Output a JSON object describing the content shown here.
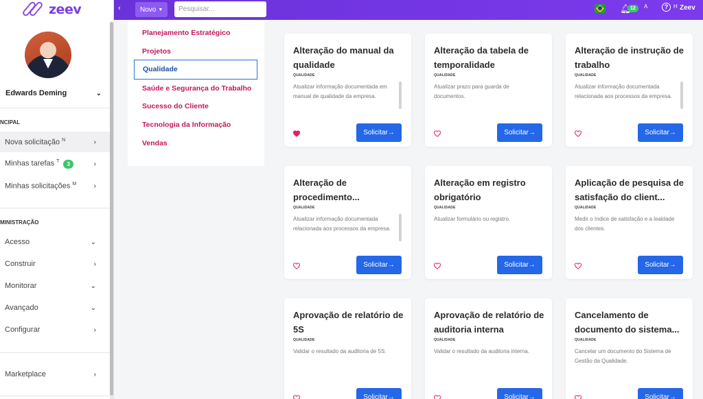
{
  "brand": {
    "logo_text": "zeev"
  },
  "topbar": {
    "back": "‹",
    "novo_label": "Novo",
    "search_placeholder": "Pesquisar...",
    "notification_count": "12",
    "letter_a": "A",
    "letter_h": "H",
    "user_short": "Zeev"
  },
  "sidebar": {
    "user_name": "Edwards Deming",
    "section_principal": "NCIPAL",
    "section_admin": "MINISTRAÇÃO",
    "principal_items": [
      {
        "label": "Nova solicitação",
        "sup": "N"
      },
      {
        "label": "Minhas tarefas",
        "sup": "T",
        "badge": "3"
      },
      {
        "label": "Minhas solicitações",
        "sup": "M"
      }
    ],
    "admin_items": [
      {
        "label": "Acesso",
        "chevron": "⌄"
      },
      {
        "label": "Construir",
        "chevron": "›"
      },
      {
        "label": "Monitorar",
        "chevron": "⌄"
      },
      {
        "label": "Avançado",
        "chevron": "⌄"
      },
      {
        "label": "Configurar",
        "chevron": "›"
      }
    ],
    "marketplace": "Marketplace"
  },
  "categories": [
    "Planejamento Estratégico",
    "Projetos",
    "Qualidade",
    "Saúde e Segurança do Trabalho",
    "Sucesso do Cliente",
    "Tecnologia da Informação",
    "Vendas"
  ],
  "button_label": "Solicitar→",
  "cards": [
    {
      "title": "Alteração do manual da qualidade",
      "tag": "QUALIDADE",
      "desc": "Atualizar informação documentada em manual de qualidade da empresa.",
      "favorite": true,
      "scroll": true
    },
    {
      "title": "Alteração da tabela de temporalidade",
      "tag": "QUALIDADE",
      "desc": "Atualizar prazo para guarda de documentos.",
      "favorite": false,
      "scroll": false
    },
    {
      "title": "Alteração de instrução de trabalho",
      "tag": "QUALIDADE",
      "desc": "Atualizar informação documentada relacionada aos processos da empresa.",
      "favorite": false,
      "scroll": true
    },
    {
      "title": "Alteração de procedimento...",
      "tag": "QUALIDADE",
      "desc": "Atualizar informação documentada relacionada aos processos da empresa.",
      "favorite": false,
      "scroll": true
    },
    {
      "title": "Alteração em registro obrigatório",
      "tag": "QUALIDADE",
      "desc": "Atualizar formulário ou registro.",
      "favorite": false,
      "scroll": false
    },
    {
      "title": "Aplicação de pesquisa de satisfação do client...",
      "tag": "QUALIDADE",
      "desc": "Medir o índice de satisfação e a lealdade dos clientes.",
      "favorite": false,
      "scroll": false
    },
    {
      "title": "Aprovação de relatório de 5S",
      "tag": "QUALIDADE",
      "desc": "Validar o resultado da auditoria de 5S.",
      "favorite": false,
      "scroll": false
    },
    {
      "title": "Aprovação de relatório de auditoria interna",
      "tag": "QUALIDADE",
      "desc": "Validar o resultado da auditoria interna.",
      "favorite": false,
      "scroll": false
    },
    {
      "title": "Cancelamento de documento do sistema...",
      "tag": "QUALIDADE",
      "desc": "Cancelar um documento do Sistema de Gestão da Qualidade.",
      "favorite": false,
      "scroll": false
    }
  ],
  "colors": {
    "accent": "#7c3aed",
    "button": "#2467e8",
    "category": "#c2185b",
    "heart": "#e0245e"
  }
}
